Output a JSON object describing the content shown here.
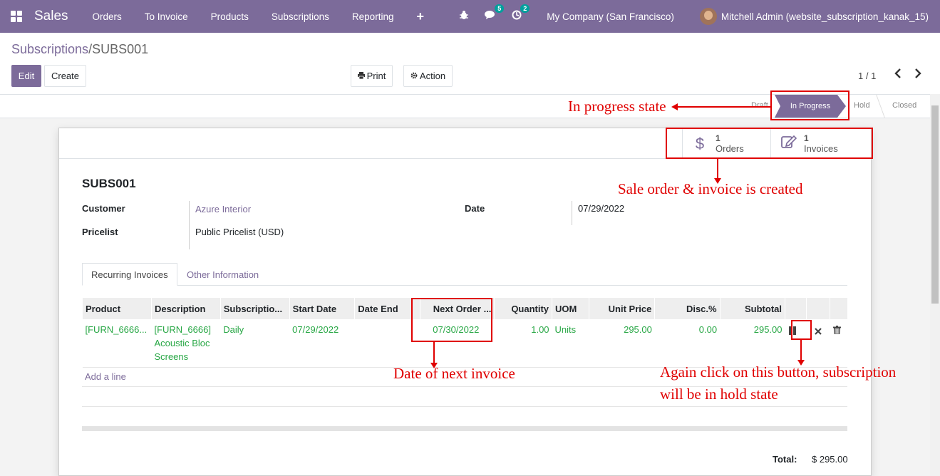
{
  "navbar": {
    "app_name": "Sales",
    "menu": [
      "Orders",
      "To Invoice",
      "Products",
      "Subscriptions",
      "Reporting"
    ],
    "plus_icon": "+",
    "bug_icon": "bug-icon",
    "messages_badge": "5",
    "activity_badge": "2",
    "company": "My Company (San Francisco)",
    "user": "Mitchell Admin (website_subscription_kanak_15)"
  },
  "breadcrumb": {
    "parent": "Subscriptions",
    "separator": "/",
    "current": "SUBS001"
  },
  "controls": {
    "edit": "Edit",
    "create": "Create",
    "print": "Print",
    "action": "Action",
    "pager": "1 / 1"
  },
  "statusbar": {
    "stages": [
      "Draft",
      "In Progress",
      "Hold",
      "Closed"
    ],
    "active": "In Progress"
  },
  "smart_buttons": {
    "orders": {
      "count": "1",
      "label": "Orders"
    },
    "invoices": {
      "count": "1",
      "label": "Invoices"
    }
  },
  "record": {
    "name": "SUBS001",
    "customer_label": "Customer",
    "customer": "Azure Interior",
    "pricelist_label": "Pricelist",
    "pricelist": "Public Pricelist (USD)",
    "date_label": "Date",
    "date": "07/29/2022"
  },
  "tabs": [
    "Recurring Invoices",
    "Other Information"
  ],
  "table": {
    "headers": [
      "Product",
      "Description",
      "Subscriptio...",
      "Start Date",
      "Date End",
      "Next Order ...",
      "Quantity",
      "UOM",
      "Unit Price",
      "Disc.%",
      "Subtotal"
    ],
    "row": {
      "product": "[FURN_6666...",
      "description_1": "[FURN_6666]",
      "description_2": "Acoustic Bloc",
      "description_3": "Screens",
      "subscription": "Daily",
      "start_date": "07/29/2022",
      "date_end": "",
      "next_order": "07/30/2022",
      "quantity": "1.00",
      "uom": "Units",
      "unit_price": "295.00",
      "discount": "0.00",
      "subtotal": "295.00"
    },
    "add_line": "Add a line"
  },
  "totals": {
    "label": "Total:",
    "value": "$ 295.00"
  },
  "annotations": {
    "state": "In progress state",
    "created": "Sale order & invoice is created",
    "next_invoice": "Date of next invoice",
    "hold_1": "Again click on this button, subscription",
    "hold_2": "will be in hold state"
  },
  "colors": {
    "brand": "#7c6b9a",
    "line_text": "#28a745",
    "annotation": "#e00000"
  }
}
